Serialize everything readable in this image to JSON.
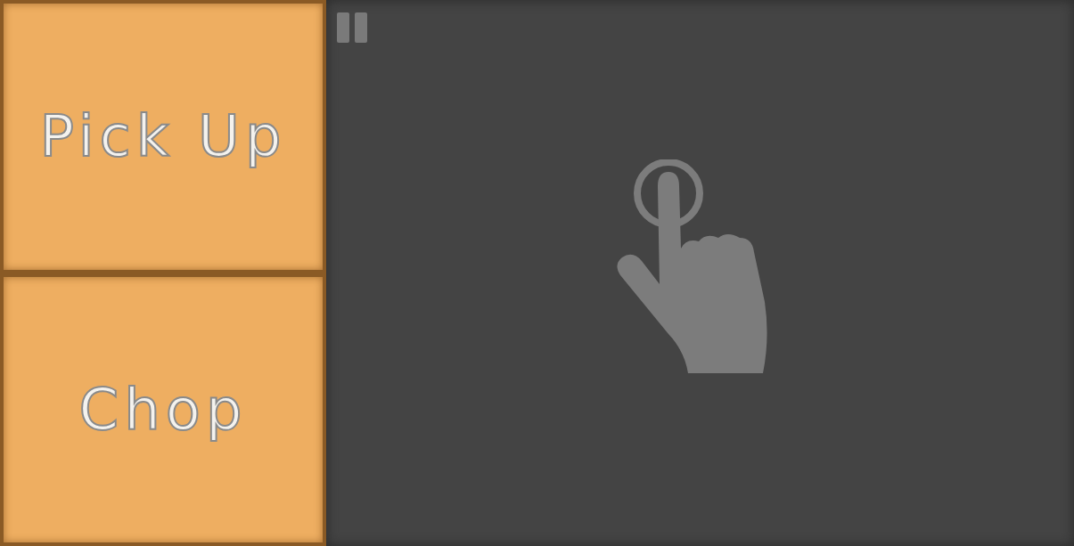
{
  "actions": [
    {
      "label": "Pick Up"
    },
    {
      "label": "Chop"
    }
  ]
}
